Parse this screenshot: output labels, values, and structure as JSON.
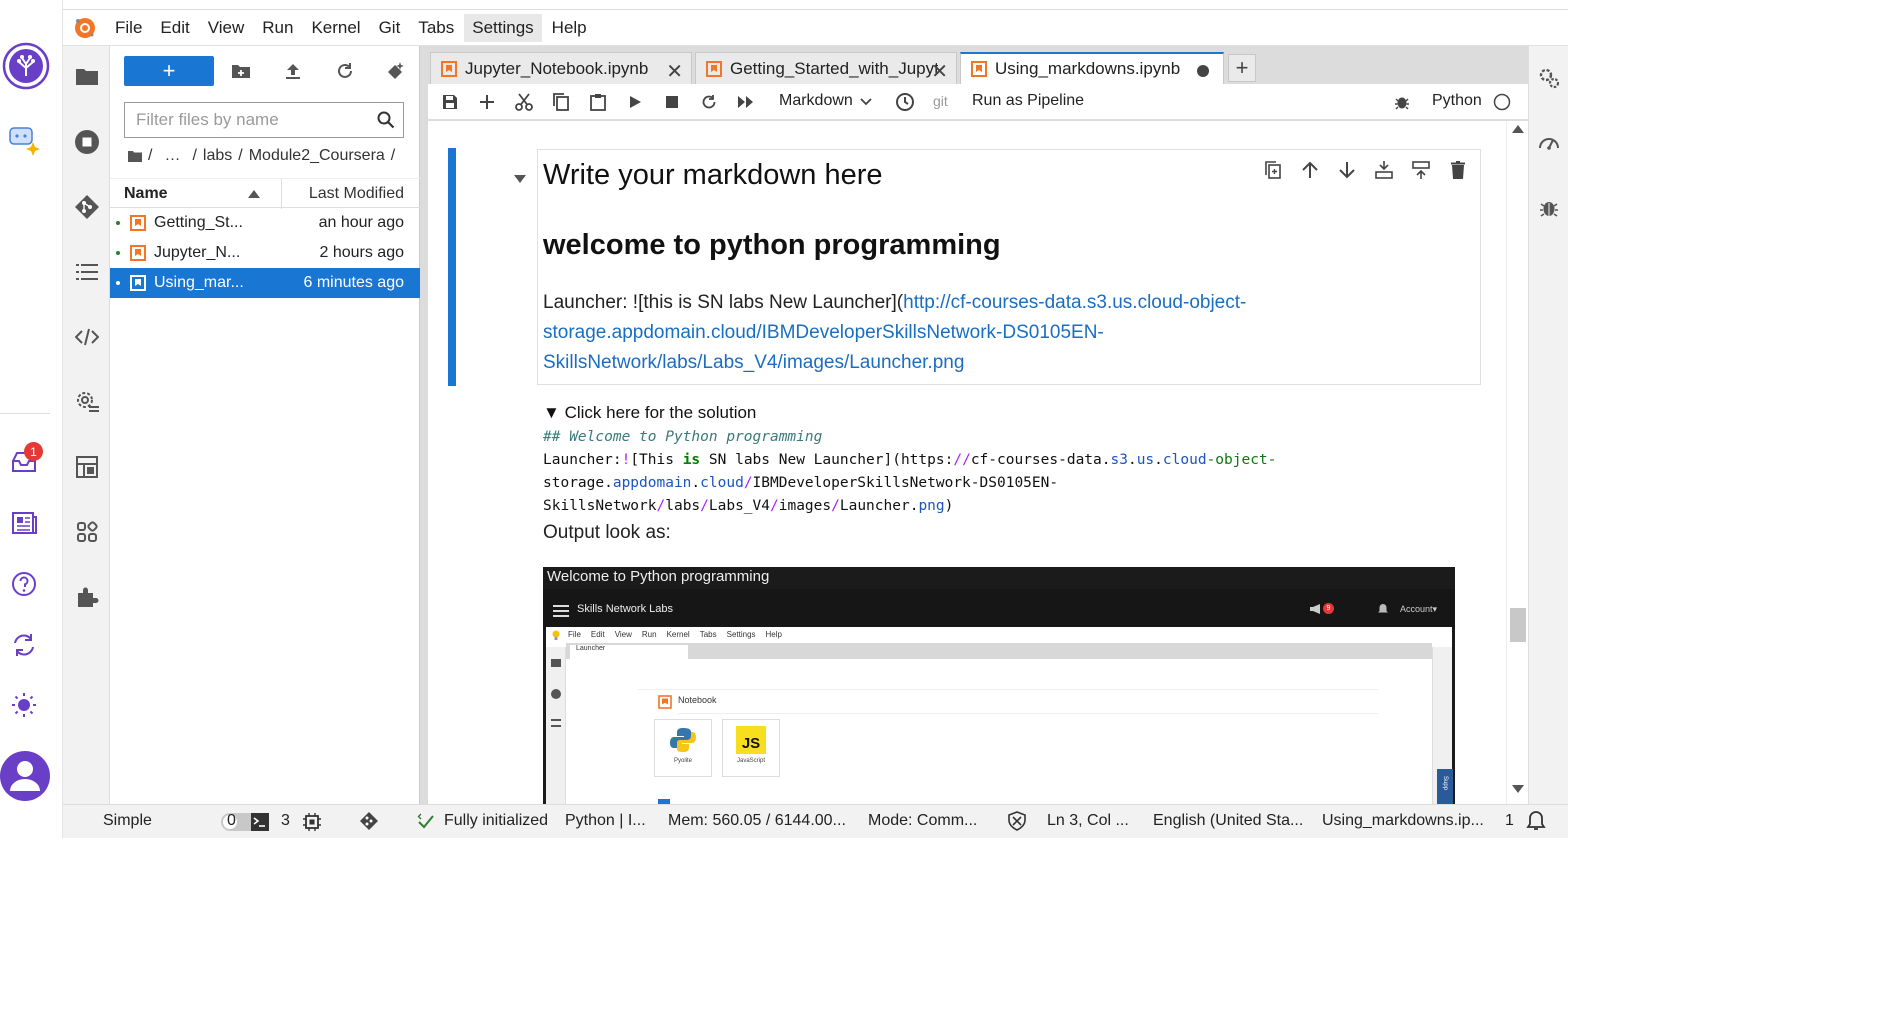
{
  "menubar": {
    "items": [
      "File",
      "Edit",
      "View",
      "Run",
      "Kernel",
      "Git",
      "Tabs",
      "Settings",
      "Help"
    ],
    "active": "Settings"
  },
  "outer_sidebar": {
    "badge_count": "1"
  },
  "filebrowser": {
    "new_label": "+",
    "filter_placeholder": "Filter files by name",
    "breadcrumbs": [
      "/",
      "…",
      "/",
      "labs",
      "/",
      "Module2_Coursera",
      "/"
    ],
    "columns": {
      "name": "Name",
      "modified": "Last Modified"
    },
    "files": [
      {
        "name": "Getting_St...",
        "modified": "an hour ago",
        "selected": false
      },
      {
        "name": "Jupyter_N...",
        "modified": "2 hours ago",
        "selected": false
      },
      {
        "name": "Using_mar...",
        "modified": "6 minutes ago",
        "selected": true
      }
    ]
  },
  "tabs": [
    {
      "label": "Jupyter_Notebook.ipynb",
      "active": false
    },
    {
      "label": "Getting_Started_with_Jupyt",
      "active": false
    },
    {
      "label": "Using_markdowns.ipynb",
      "active": true
    }
  ],
  "toolbar": {
    "cell_type": "Markdown",
    "git_label": "git",
    "pipeline_label": "Run as Pipeline",
    "kernel_name": "Python"
  },
  "notebook": {
    "heading1": "Write your markdown here",
    "heading2": "welcome to python programming",
    "para_prefix": "Launcher: ![this is SN labs New Launcher](",
    "link_line1": "http://cf-courses-data.s3.us.cloud-object-",
    "link_line2": "storage.appdomain.cloud/IBMDeveloperSkillsNetwork-DS0105EN-",
    "link_line3": "SkillsNetwork/labs/Labs_V4/images/Launcher.png",
    "details_summary": "Click here for the solution",
    "code_comment": "## Welcome to Python programming",
    "code_line1_a": "Launcher:",
    "code_line1_b": "!",
    "code_line1_c": "[This ",
    "code_line1_kw": "is",
    "code_line1_d": " SN labs New Launcher](https:",
    "code_line1_e": "//",
    "code_line1_f": "cf-courses-data.",
    "code_line1_g": "s3",
    "code_line1_h": ".",
    "code_line1_i": "us",
    "code_line1_j": ".",
    "code_line1_k": "cloud",
    "code_line1_l": "-object-",
    "code_line2_a": "storage.",
    "code_line2_b": "appdomain",
    "code_line2_c": ".",
    "code_line2_d": "cloud",
    "code_line2_e": "/",
    "code_line2_f": "IBMDeveloperSkillsNetwork-DS0105EN-",
    "code_line3_a": "SkillsNetwork",
    "code_line3_b": "/",
    "code_line3_c": "labs",
    "code_line3_d": "/",
    "code_line3_e": "Labs_V4",
    "code_line3_f": "/",
    "code_line3_g": "images",
    "code_line3_h": "/",
    "code_line3_i": "Launcher.",
    "code_line3_j": "png",
    "code_line3_k": ")",
    "output_label": "Output look as:"
  },
  "embedded_screenshot": {
    "title": "Welcome to Python programming",
    "brand": "Skills Network Labs",
    "account": "Account▾",
    "notif_count": "9",
    "menu": [
      "File",
      "Edit",
      "View",
      "Run",
      "Kernel",
      "Tabs",
      "Settings",
      "Help"
    ],
    "tab": "Launcher",
    "section": "Notebook",
    "cards": [
      "Pyolite",
      "JavaScript"
    ],
    "js_glyph": "JS",
    "side_label": "Supp"
  },
  "statusbar": {
    "mode_label": "Simple",
    "terminals": "0",
    "kernels": "3",
    "init_status": "Fully initialized",
    "kernel": "Python | I...",
    "memory": "Mem: 560.05 / 6144.00...",
    "mode": "Mode: Comm...",
    "cursor": "Ln 3, Col ...",
    "language": "English (United Sta...",
    "file": "Using_markdowns.ip...",
    "notifications": "1"
  },
  "colors": {
    "accent": "#1976d2",
    "link": "#1a6ec2",
    "brand_purple": "#6a3fc8",
    "notebook_orange": "#f37626",
    "badge_red": "#e53935"
  }
}
